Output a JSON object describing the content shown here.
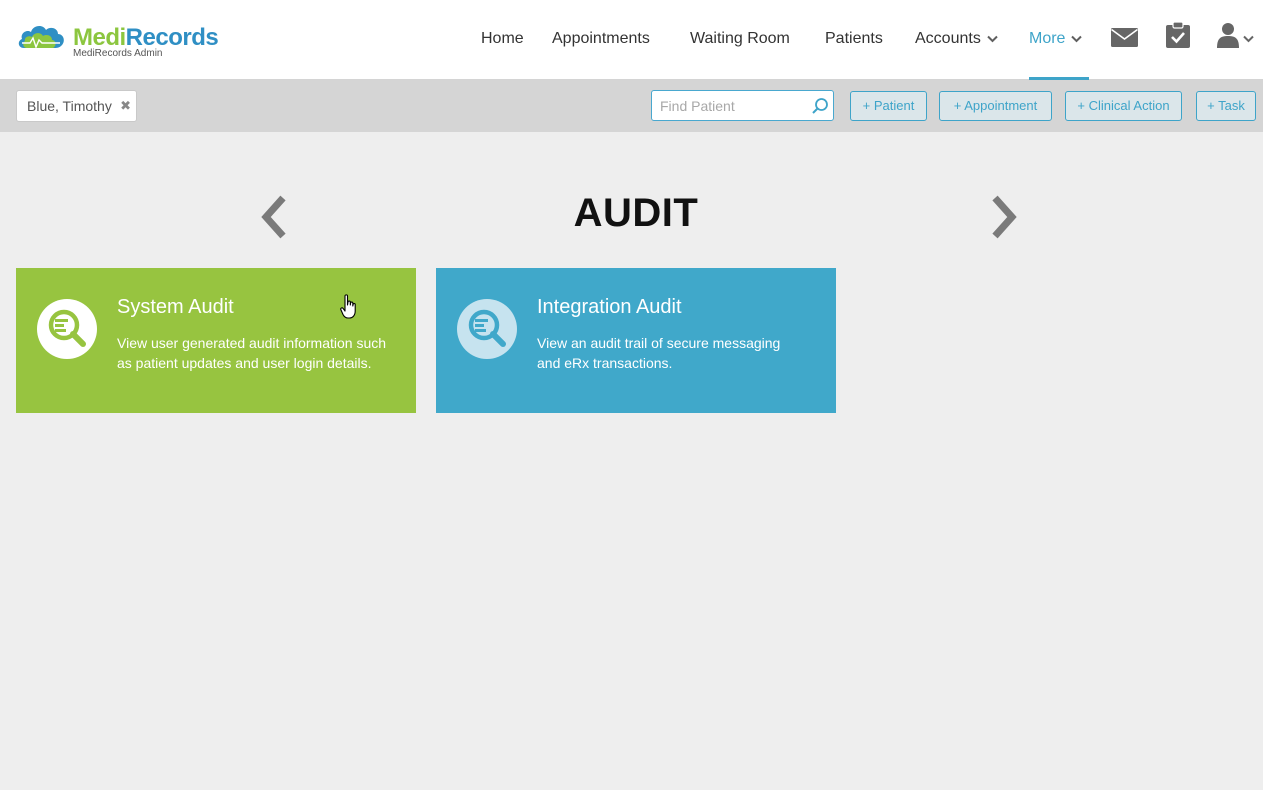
{
  "brand": {
    "name_part1": "Medi",
    "name_part2": "Records",
    "subtitle": "MediRecords Admin",
    "colors": {
      "green": "#8cc63f",
      "blue": "#2f8fc4"
    }
  },
  "nav": {
    "items": [
      {
        "label": "Home"
      },
      {
        "label": "Appointments"
      },
      {
        "label": "Waiting Room"
      },
      {
        "label": "Patients"
      },
      {
        "label": "Accounts",
        "dropdown": true
      },
      {
        "label": "More",
        "dropdown": true,
        "active": true
      }
    ],
    "icons": [
      "mail-icon",
      "clipboard-check-icon",
      "user-icon"
    ],
    "active_color": "#3ea4c9"
  },
  "toolbar": {
    "patient_tag": "Blue, Timothy",
    "search_placeholder": "Find Patient",
    "buttons": [
      "+ Patient",
      "+ Appointment",
      "+ Clinical Action",
      "+ Task"
    ]
  },
  "page": {
    "title": "AUDIT"
  },
  "cards": [
    {
      "title": "System Audit",
      "description": "View user generated audit information such as patient updates and user login details.",
      "color": "#97c440",
      "icon": "audit-search-icon"
    },
    {
      "title": "Integration Audit",
      "description": "View an audit trail of secure messaging and eRx transactions.",
      "color": "#40a8ca",
      "icon": "audit-search-icon"
    }
  ]
}
